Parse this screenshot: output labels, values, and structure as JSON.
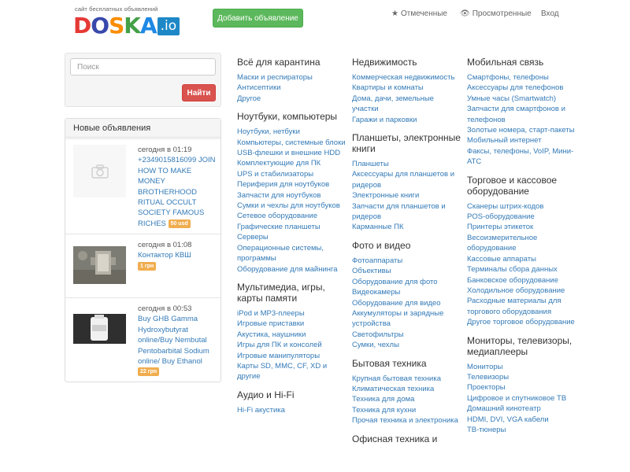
{
  "logo": {
    "tagline": "сайт бесплатных объявлений",
    "letters": [
      {
        "ch": "D",
        "color": "#e53935"
      },
      {
        "ch": "O",
        "color": "#3949ab"
      },
      {
        "ch": "S",
        "color": "#fb8c00"
      },
      {
        "ch": "K",
        "color": "#43a047"
      },
      {
        "ch": "A",
        "color": "#1e88e5"
      }
    ],
    "tld": ".io"
  },
  "header": {
    "add_button": "Добавить объявление",
    "nav": [
      {
        "icon": "★",
        "label": "Отмеченные"
      },
      {
        "icon": "👁",
        "label": "Просмотренные"
      },
      {
        "icon": "",
        "label": "Вход"
      }
    ]
  },
  "search": {
    "placeholder": "Поиск",
    "button": "Найти"
  },
  "new_ads": {
    "title": "Новые объявления",
    "items": [
      {
        "date": "сегодня в 01:19",
        "title": "+2349015816099 JOIN HOW TO MAKE MONEY BROTHERHOOD RITUAL OCCULT SOCIETY FAMOUS RICHES",
        "price": "50 usd"
      },
      {
        "date": "сегодня в 01:08",
        "title": "Контактор КВШ",
        "price": "1 грн"
      },
      {
        "date": "сегодня в 00:53",
        "title": "Buy GHB Gamma Hydroxybutyrat online/Buy Nembutal Pentobarbital Sodium online/ Buy Ethanol",
        "price": "22 грн"
      }
    ]
  },
  "columns": [
    [
      {
        "title": "Всё для карантина",
        "links": [
          "Маски и респираторы",
          "Антисептики",
          "Другое"
        ]
      },
      {
        "title": "Ноутбуки, компьютеры",
        "links": [
          "Ноутбуки, нетбуки",
          "Компьютеры, системные блоки",
          "USB-флешки и внешние HDD",
          "Комплектующие для ПК",
          "UPS и стабилизаторы",
          "Периферия для ноутбуков",
          "Запчасти для ноутбуков",
          "Сумки и чехлы для ноутбуков",
          "Сетевое оборудование",
          "Графические планшеты",
          "Серверы",
          "Операционные системы, программы",
          "Оборудование для майнинга"
        ]
      },
      {
        "title": "Мультимедиа, игры, карты памяти",
        "links": [
          "iPod и MP3-плееры",
          "Игровые приставки",
          "Акустика, наушники",
          "Игры для ПК и консолей",
          "Игровые манипуляторы",
          "Карты SD, MMC, CF, XD и другие"
        ]
      },
      {
        "title": "Аудио и Hi-Fi",
        "links": [
          "Hi-Fi акустика"
        ]
      }
    ],
    [
      {
        "title": "Недвижимость",
        "links": [
          "Коммерческая недвижимость",
          "Квартиры и комнаты",
          "Дома, дачи, земельные участки",
          "Гаражи и парковки"
        ]
      },
      {
        "title": "Планшеты, электронные книги",
        "links": [
          "Планшеты",
          "Аксессуары для планшетов и ридеров",
          "Электронные книги",
          "Запчасти для планшетов и ридеров",
          "Карманные ПК"
        ]
      },
      {
        "title": "Фото и видео",
        "links": [
          "Фотоаппараты",
          "Объективы",
          "Оборудование для фото",
          "Видеокамеры",
          "Оборудование для видео",
          "Аккумуляторы и зарядные устройства",
          "Светофильтры",
          "Сумки, чехлы"
        ]
      },
      {
        "title": "Бытовая техника",
        "links": [
          "Крупная бытовая техника",
          "Климатическая техника",
          "Техника для дома",
          "Техника для кухни",
          "Прочая техника и электроника"
        ]
      },
      {
        "title": "Офисная техника и",
        "links": []
      }
    ],
    [
      {
        "title": "Мобильная связь",
        "links": [
          "Смартфоны, телефоны",
          "Аксессуары для телефонов",
          "Умные часы (Smartwatch)",
          "Запчасти для смартфонов и телефонов",
          "Золотые номера, старт-пакеты",
          "Мобильный интернет",
          "Факсы, телефоны, VoIP, Мини-АТС"
        ]
      },
      {
        "title": "Торговое и кассовое оборудование",
        "links": [
          "Сканеры штрих-кодов",
          "POS-оборудование",
          "Принтеры этикеток",
          "Весоизмерительное оборудование",
          "Кассовые аппараты",
          "Терминалы сбора данных",
          "Банковское оборудование",
          "Холодильное оборудование",
          "Расходные материалы для торгового оборудования",
          "Другое торговое оборудование"
        ]
      },
      {
        "title": "Мониторы, телевизоры, медиаплееры",
        "links": [
          "Мониторы",
          "Телевизоры",
          "Проекторы",
          "Цифровое и спутниковое ТВ",
          "Домашний кинотеатр",
          "HDMI, DVI, VGA кабели",
          "ТВ-тюнеры"
        ]
      }
    ]
  ]
}
